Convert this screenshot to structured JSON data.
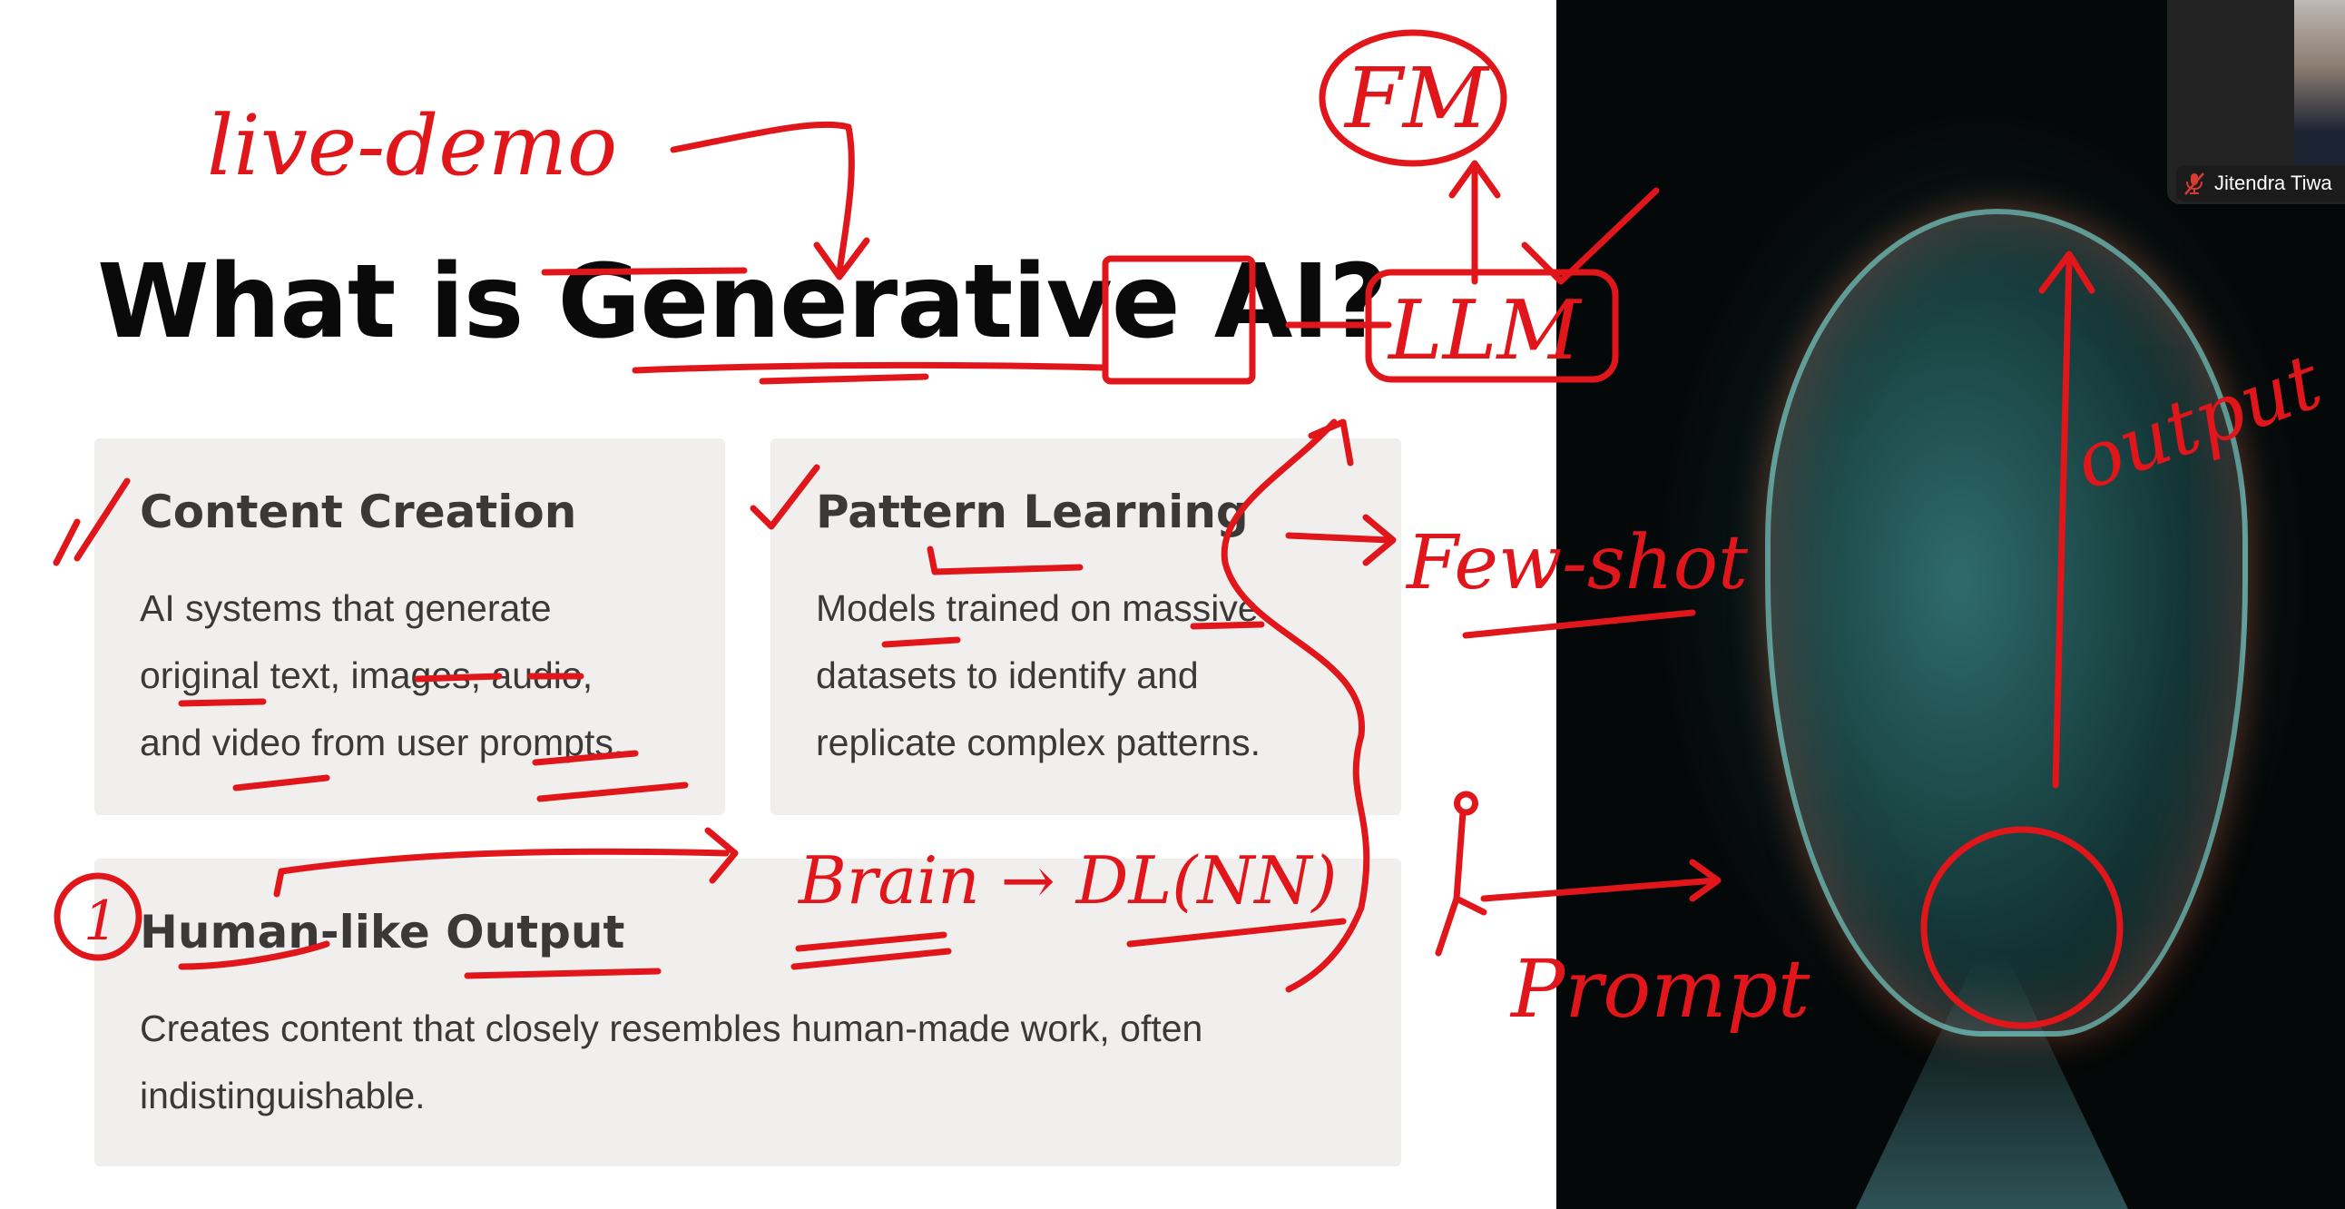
{
  "slide": {
    "title": "What is Generative AI?",
    "cards": [
      {
        "heading": "Content Creation",
        "body_lines": [
          "AI systems that generate",
          "original text, images, audio,",
          "and video from user prompts."
        ]
      },
      {
        "heading": "Pattern Learning",
        "body_lines": [
          "Models trained on massive",
          "datasets to identify and",
          "replicate complex patterns."
        ]
      },
      {
        "heading": "Human-like Output",
        "body_lines": [
          "Creates content that closely resembles human-made work, often",
          "indistinguishable."
        ]
      }
    ]
  },
  "video_tile": {
    "participant_name": "Jitendra Tiwa",
    "mic_icon": "mic-muted-icon",
    "mic_color": "#d93a32"
  },
  "annotations": {
    "color": "#e0161b",
    "live_demo": "live-demo",
    "fm": "FM",
    "llm": "LLM",
    "few_shot": "Few-shot",
    "brain_dl": "Brain → DL(NN)",
    "prompt": "Prompt",
    "output": "output",
    "one": "1"
  }
}
